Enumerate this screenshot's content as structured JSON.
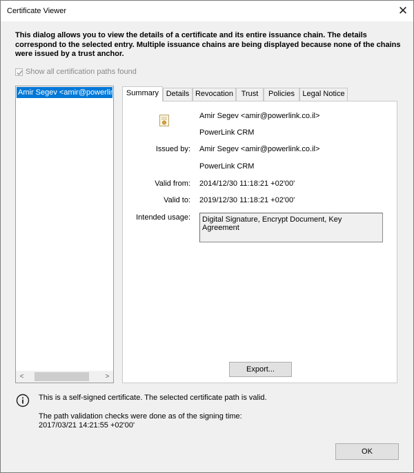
{
  "window": {
    "title": "Certificate Viewer"
  },
  "intro_text": "This dialog allows you to view the details of a certificate and its entire issuance chain. The details correspond to the selected entry. Multiple issuance chains are being displayed because none of the chains were issued by a trust anchor.",
  "show_all_paths": {
    "label": "Show all certification paths found",
    "checked": true,
    "enabled": false
  },
  "path_list": {
    "items": [
      "Amir Segev <amir@powerlink.co.il>"
    ],
    "selected_index": 0
  },
  "tabs": [
    {
      "label": "Summary",
      "active": true
    },
    {
      "label": "Details"
    },
    {
      "label": "Revocation"
    },
    {
      "label": "Trust"
    },
    {
      "label": "Policies"
    },
    {
      "label": "Legal Notice"
    }
  ],
  "summary": {
    "subject_name": "Amir Segev <amir@powerlink.co.il>",
    "subject_org": "PowerLink CRM",
    "issued_by_label": "Issued by:",
    "issuer_name": "Amir Segev <amir@powerlink.co.il>",
    "issuer_org": "PowerLink CRM",
    "valid_from_label": "Valid from:",
    "valid_from": "2014/12/30 11:18:21 +02'00'",
    "valid_to_label": "Valid to:",
    "valid_to": "2019/12/30 11:18:21 +02'00'",
    "usage_label": "Intended usage:",
    "usage": "Digital Signature, Encrypt Document, Key Agreement"
  },
  "export_button": {
    "label": "Export..."
  },
  "status": {
    "message": "This is a self-signed certificate. The selected certificate path is valid.",
    "validation_note": "The path validation checks were done as of the signing time:",
    "validation_time": "2017/03/21 14:21:55 +02'00'"
  },
  "ok_button": {
    "label": "OK"
  },
  "colors": {
    "selection": "#0078d7",
    "dialog_bg": "#f0f0f0",
    "button_bg": "#e1e1e1"
  },
  "icons": [
    "close-icon",
    "certificate-icon",
    "info-icon",
    "scroll-left-icon",
    "scroll-right-icon",
    "checkmark-icon"
  ]
}
